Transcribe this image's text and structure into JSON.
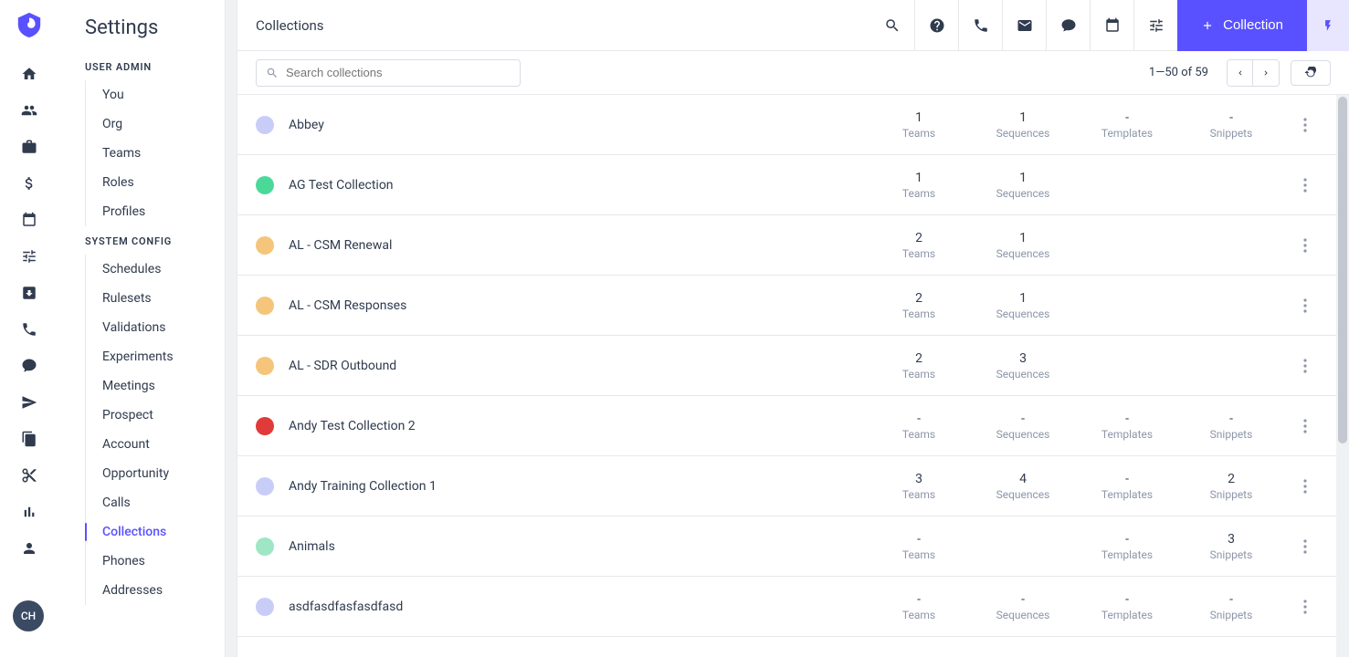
{
  "rail": {
    "avatar_initials": "CH"
  },
  "settings": {
    "title": "Settings",
    "section_user_admin": "USER ADMIN",
    "section_system_config": "SYSTEM CONFIG",
    "user_admin_items": [
      "You",
      "Org",
      "Teams",
      "Roles",
      "Profiles"
    ],
    "system_config_items": [
      "Schedules",
      "Rulesets",
      "Validations",
      "Experiments",
      "Meetings",
      "Prospect",
      "Account",
      "Opportunity",
      "Calls",
      "Collections",
      "Phones",
      "Addresses"
    ],
    "active_item": "Collections"
  },
  "header": {
    "title": "Collections",
    "new_button_label": "Collection"
  },
  "toolbar": {
    "search_placeholder": "Search collections",
    "page_info": "1—50 of 59"
  },
  "stat_labels": {
    "teams": "Teams",
    "sequences": "Sequences",
    "templates": "Templates",
    "snippets": "Snippets"
  },
  "rows": [
    {
      "name": "Abbey",
      "color": "#c8cdf8",
      "teams": "1",
      "sequences": "1",
      "templates": "-",
      "snippets": "-"
    },
    {
      "name": "AG Test Collection",
      "color": "#4bd99a",
      "teams": "1",
      "sequences": "1",
      "templates": null,
      "snippets": null
    },
    {
      "name": "AL - CSM Renewal",
      "color": "#f4c57a",
      "teams": "2",
      "sequences": "1",
      "templates": null,
      "snippets": null
    },
    {
      "name": "AL - CSM Responses",
      "color": "#f4c57a",
      "teams": "2",
      "sequences": "1",
      "templates": null,
      "snippets": null
    },
    {
      "name": "AL - SDR Outbound",
      "color": "#f4c57a",
      "teams": "2",
      "sequences": "3",
      "templates": null,
      "snippets": null
    },
    {
      "name": "Andy Test Collection 2",
      "color": "#e13a3a",
      "teams": "-",
      "sequences": "-",
      "templates": "-",
      "snippets": "-"
    },
    {
      "name": "Andy Training Collection 1",
      "color": "#c8cdf8",
      "teams": "3",
      "sequences": "4",
      "templates": "-",
      "snippets": "2"
    },
    {
      "name": "Animals",
      "color": "#9ee6c5",
      "teams": "-",
      "sequences": null,
      "templates": "-",
      "snippets": "3"
    },
    {
      "name": "asdfasdfasfasdfasd",
      "color": "#c8cdf8",
      "teams": "-",
      "sequences": "-",
      "templates": "-",
      "snippets": "-"
    }
  ]
}
